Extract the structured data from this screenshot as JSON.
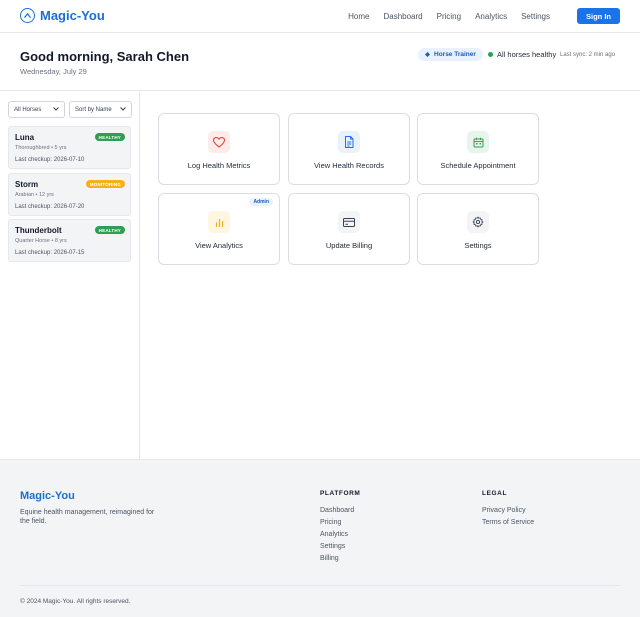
{
  "nav": {
    "brand": "Magic-You",
    "links": [
      "Home",
      "Dashboard",
      "Pricing",
      "Analytics",
      "Settings"
    ],
    "signin_label": "Sign In"
  },
  "header": {
    "greeting": "Good morning, Sarah Chen",
    "date": "Wednesday, July 29",
    "role_badge": "Horse Trainer",
    "status": "All horses healthy",
    "sync": "Last sync: 2 min ago"
  },
  "sidebar": {
    "filter_label": "All Horses",
    "sort_label": "Sort by Name",
    "horses": [
      {
        "name": "Luna",
        "breed": "Thoroughbred • 5 yrs",
        "checkup": "Last checkup: 2026-07-10",
        "status": "HEALTHY"
      },
      {
        "name": "Storm",
        "breed": "Arabian • 12 yrs",
        "checkup": "Last checkup: 2026-07-20",
        "status": "MONITORING"
      },
      {
        "name": "Thunderbolt",
        "breed": "Quarter Horse • 8 yrs",
        "checkup": "Last checkup: 2026-07-15",
        "status": "HEALTHY"
      }
    ]
  },
  "actions": [
    {
      "label": "Log Health Metrics",
      "icon": "heart-icon",
      "color": "#e0453a"
    },
    {
      "label": "View Health Records",
      "icon": "document-icon",
      "color": "#1a73e8"
    },
    {
      "label": "Schedule Appointment",
      "icon": "calendar-icon",
      "color": "#2f9e53"
    },
    {
      "label": "View Analytics",
      "icon": "bar-chart-icon",
      "color": "#f5b217",
      "tag": "Admin"
    },
    {
      "label": "Update Billing",
      "icon": "credit-card-icon",
      "color": "#374151"
    },
    {
      "label": "Settings",
      "icon": "gear-icon",
      "color": "#374151"
    }
  ],
  "footer": {
    "brand": "Magic-You",
    "tagline": "Equine health management, reimagined for the field.",
    "platform_title": "PLATFORM",
    "platform_links": [
      "Dashboard",
      "Pricing",
      "Analytics",
      "Settings",
      "Billing"
    ],
    "legal_title": "LEGAL",
    "legal_links": [
      "Privacy Policy",
      "Terms of Service"
    ],
    "copyright": "© 2024 Magic-You. All rights reserved."
  },
  "colors": {
    "brand": "#1a6fd1",
    "healthy": "#2f9e53",
    "monitoring": "#f5b217"
  }
}
